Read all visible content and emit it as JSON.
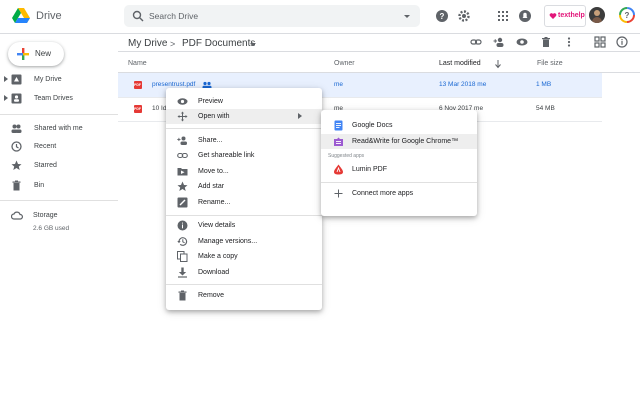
{
  "app": {
    "name": "Drive"
  },
  "search": {
    "placeholder": "Search Drive"
  },
  "header": {
    "icons": [
      "help-icon",
      "settings-icon",
      "apps-grid-icon",
      "notifications-icon",
      "avatar",
      "google-account-icon"
    ],
    "texthelp_label": "texthelp"
  },
  "sidebar": {
    "new_label": "New",
    "items": [
      {
        "label": "My Drive",
        "icon": "my-drive-icon",
        "expandable": true
      },
      {
        "label": "Team Drives",
        "icon": "team-drives-icon",
        "expandable": true
      },
      {
        "label": "Shared with me",
        "icon": "shared-icon"
      },
      {
        "label": "Recent",
        "icon": "clock-icon"
      },
      {
        "label": "Starred",
        "icon": "star-icon"
      },
      {
        "label": "Bin",
        "icon": "trash-icon"
      }
    ],
    "storage_label": "Storage",
    "storage_used": "2.6 GB used"
  },
  "breadcrumb": {
    "root": "My Drive",
    "sep": ">",
    "current": "PDF Documents"
  },
  "columns": {
    "name": "Name",
    "owner": "Owner",
    "modified": "Last modified",
    "size": "File size"
  },
  "files": [
    {
      "name": "presentrust.pdf",
      "owner": "me",
      "modified": "13 Mar 2018 me",
      "size": "1 MB",
      "selected": true
    },
    {
      "name": "10 Id",
      "owner": "me",
      "modified": "6 Nov 2017 me",
      "size": "54 MB",
      "selected": false
    }
  ],
  "context_menu": {
    "items": [
      {
        "label": "Preview",
        "icon": "eye-icon"
      },
      {
        "label": "Open with",
        "icon": "move-arrows-icon",
        "submenu": true,
        "highlighted": true
      },
      {
        "label": "Share...",
        "icon": "share-person-icon"
      },
      {
        "label": "Get shareable link",
        "icon": "link-icon"
      },
      {
        "label": "Move to...",
        "icon": "folder-move-icon"
      },
      {
        "label": "Add star",
        "icon": "star-icon"
      },
      {
        "label": "Rename...",
        "icon": "rename-icon"
      },
      {
        "label": "View details",
        "icon": "info-icon"
      },
      {
        "label": "Manage versions...",
        "icon": "history-icon"
      },
      {
        "label": "Make a copy",
        "icon": "copy-icon"
      },
      {
        "label": "Download",
        "icon": "download-icon"
      },
      {
        "label": "Remove",
        "icon": "trash-icon"
      }
    ]
  },
  "open_with_menu": {
    "apps": [
      {
        "label": "Google Docs",
        "icon": "google-docs-icon"
      },
      {
        "label": "Read&Write for Google Chrome™",
        "icon": "readwrite-icon",
        "highlighted": true
      }
    ],
    "suggested_label": "Suggested apps",
    "suggested": [
      {
        "label": "Lumin PDF",
        "icon": "lumin-pdf-icon"
      }
    ],
    "connect_label": "Connect more apps"
  },
  "colors": {
    "accent_blue": "#1a73e8",
    "selected_row": "#e8f0fe",
    "pdf_red": "#e53935",
    "texthelp_pink": "#e2177a"
  }
}
